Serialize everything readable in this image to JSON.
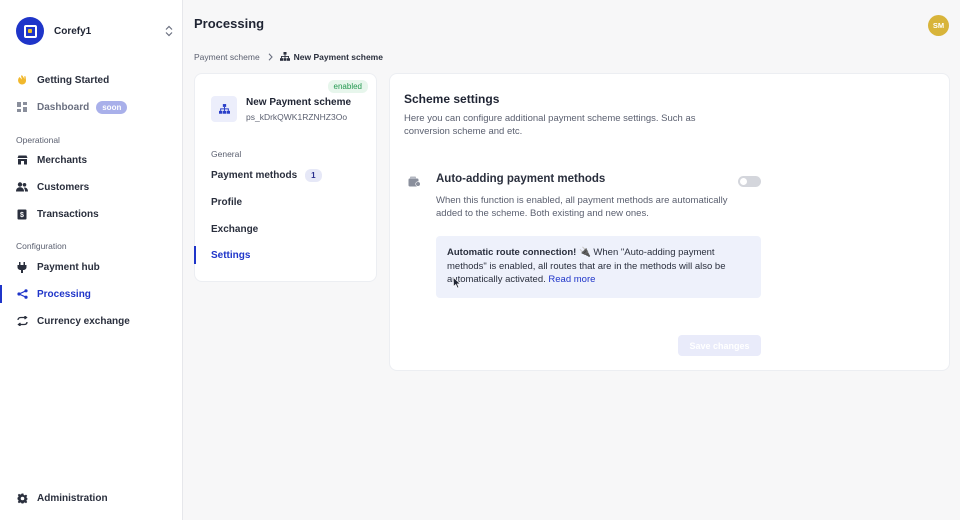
{
  "sidebar": {
    "org_name": "Corefy1",
    "items": [
      {
        "key": "getting-started",
        "label": "Getting Started",
        "icon": "wave-hand-icon"
      },
      {
        "key": "dashboard",
        "label": "Dashboard",
        "badge": "soon",
        "icon": "dashboard-icon"
      },
      {
        "key": "merchants",
        "label": "Merchants",
        "icon": "store-icon"
      },
      {
        "key": "customers",
        "label": "Customers",
        "icon": "users-icon"
      },
      {
        "key": "transactions",
        "label": "Transactions",
        "icon": "dollar-doc-icon"
      },
      {
        "key": "payment-hub",
        "label": "Payment hub",
        "icon": "plug-icon"
      },
      {
        "key": "processing",
        "label": "Processing",
        "icon": "share-icon",
        "active": true
      },
      {
        "key": "currency-exchange",
        "label": "Currency exchange",
        "icon": "exchange-arrows-icon"
      },
      {
        "key": "administration",
        "label": "Administration",
        "icon": "gear-icon"
      }
    ],
    "sections": {
      "operational": "Operational",
      "configuration": "Configuration"
    }
  },
  "header": {
    "title": "Processing",
    "avatar_initials": "SM"
  },
  "breadcrumb": {
    "parent": "Payment scheme",
    "current": "New Payment scheme"
  },
  "scheme_card": {
    "status": "enabled",
    "name": "New Payment scheme",
    "id": "ps_kDrkQWK1RZNHZ3Oo",
    "section": "General",
    "nav": [
      {
        "label": "Payment methods",
        "count": "1"
      },
      {
        "label": "Profile"
      },
      {
        "label": "Exchange"
      },
      {
        "label": "Settings",
        "active": true
      }
    ]
  },
  "settings": {
    "title": "Scheme settings",
    "description": "Here you can configure additional payment scheme settings. Such as conversion scheme and etc.",
    "feature": {
      "title": "Auto-adding payment methods",
      "enabled": false,
      "description": "When this function is enabled, all payment methods are automatically added to the scheme. Both existing and new ones."
    },
    "info": {
      "strong": "Automatic route connection! 🔌",
      "text": " When \"Auto-adding payment methods\" is enabled, all routes that are in the methods will also be automatically activated. ",
      "link": "Read more"
    },
    "save_label": "Save changes"
  },
  "colors": {
    "accent": "#1f35c9",
    "enabled_green": "#23984f",
    "avatar": "#d8b43a"
  }
}
